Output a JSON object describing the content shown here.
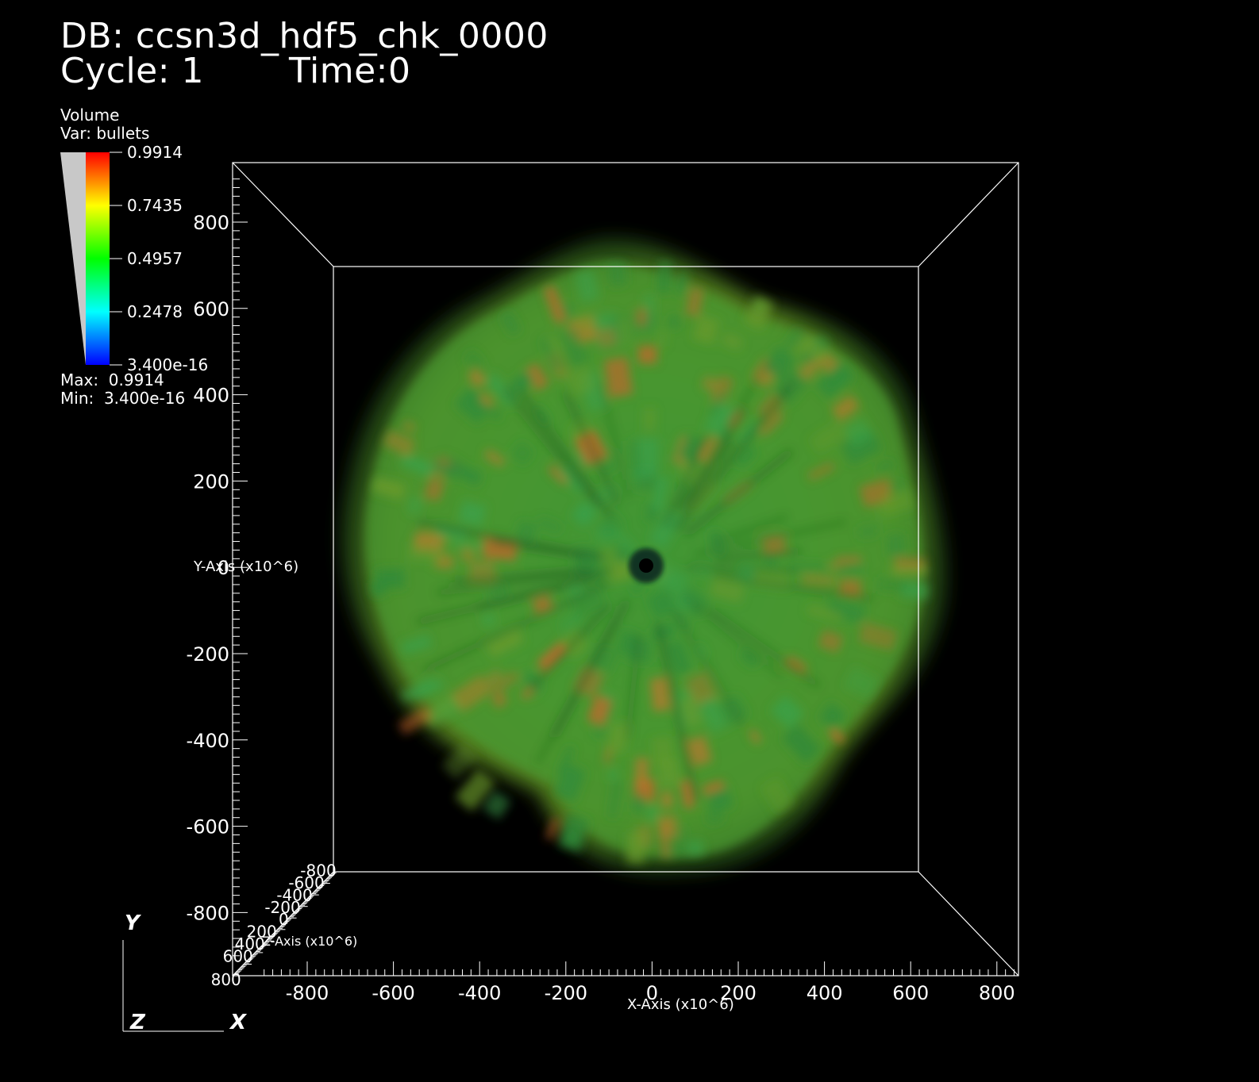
{
  "header": {
    "db_line": "DB: ccsn3d_hdf5_chk_0000",
    "cycle_label": "Cycle: 1",
    "time_label": "Time:0"
  },
  "legend": {
    "plot_type": "Volume",
    "var_label": "Var: bullets",
    "tick_labels": [
      "0.9914",
      "0.7435",
      "0.4957",
      "0.2478",
      "3.400e-16"
    ],
    "max_label": "Max:  0.9914",
    "min_label": "Min:  3.400e-16",
    "colormap": [
      "#ff0000",
      "#ffff00",
      "#00ff00",
      "#00ffff",
      "#0000ff"
    ]
  },
  "axes": {
    "y_title": "Y-Axis (x10^6)",
    "x_title": "X-Axis (x10^6)",
    "z_title": "Z-Axis (x10^6)",
    "y_tick_labels": [
      "800",
      "600",
      "400",
      "200",
      "0",
      "-200",
      "-400",
      "-600",
      "-800"
    ],
    "x_tick_labels": [
      "-800",
      "-600",
      "-400",
      "-200",
      "0",
      "200",
      "400",
      "600",
      "800"
    ],
    "z_tick_labels": [
      "800",
      "600",
      "400",
      "200",
      "0",
      "-200",
      "-400",
      "-600",
      "-800"
    ],
    "triad": {
      "y": "Y",
      "z": "Z",
      "x": "X"
    }
  },
  "colors": {
    "background": "#000000",
    "bbox": "#ffffff",
    "green": "#3fa83a",
    "orange": "#c8642a"
  }
}
